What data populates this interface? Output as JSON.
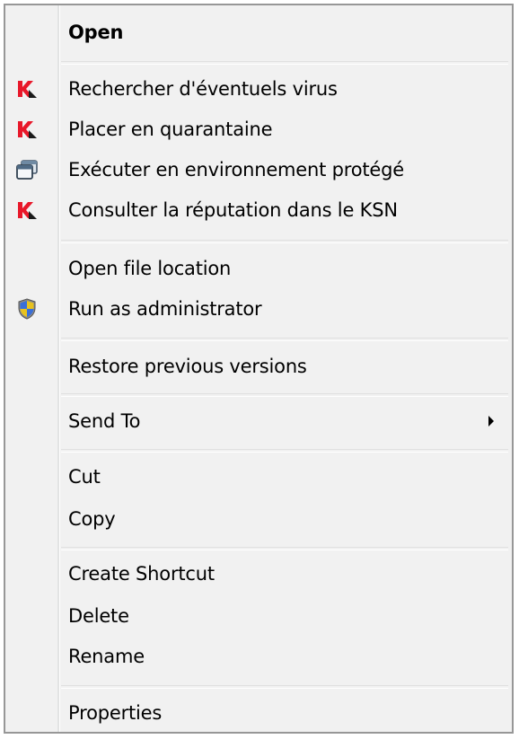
{
  "menu": {
    "items": [
      {
        "label": "Open"
      },
      {
        "label": "Rechercher d'éventuels virus",
        "icon": "kaspersky-icon"
      },
      {
        "label": "Placer en quarantaine",
        "icon": "kaspersky-icon"
      },
      {
        "label": "Exécuter en environnement protégé",
        "icon": "safe-run-window-icon"
      },
      {
        "label": "Consulter la réputation dans le KSN",
        "icon": "kaspersky-icon"
      },
      {
        "label": "Open file location"
      },
      {
        "label": "Run as administrator",
        "icon": "uac-shield-icon"
      },
      {
        "label": "Restore previous versions"
      },
      {
        "label": "Send To",
        "icon": "submenu-arrow-icon"
      },
      {
        "label": "Cut"
      },
      {
        "label": "Copy"
      },
      {
        "label": "Create Shortcut"
      },
      {
        "label": "Delete"
      },
      {
        "label": "Rename"
      },
      {
        "label": "Properties"
      }
    ]
  },
  "colors": {
    "menu_background": "#f1f1f1",
    "kaspersky_red": "#e8182a",
    "border": "#979797"
  }
}
